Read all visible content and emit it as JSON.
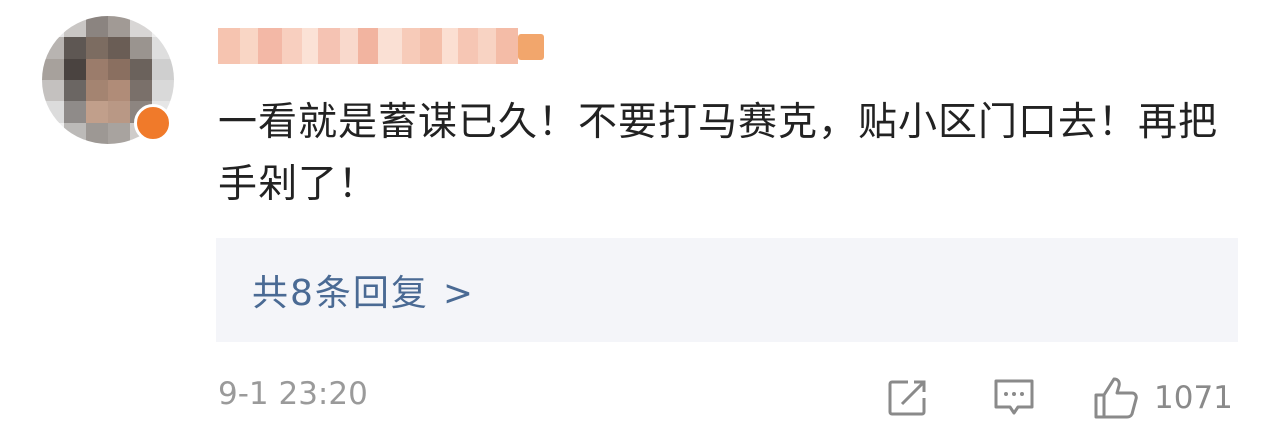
{
  "comment": {
    "avatar": {
      "icon": "user-avatar",
      "badge_color": "#f07a2a",
      "pixels": [
        "#e9e9ea",
        "#c9c6c4",
        "#8b8480",
        "#a19a95",
        "#d8d6d5",
        "#eeeeee",
        "#b8b4b1",
        "#5e5753",
        "#7c6c61",
        "#6a5d55",
        "#9a948f",
        "#dedede",
        "#a7a19c",
        "#4a4340",
        "#9b7c6b",
        "#8a6f60",
        "#6b625c",
        "#cfcfcf",
        "#c4c1bf",
        "#6b6663",
        "#a48471",
        "#b08c78",
        "#7a706a",
        "#d9d9d9",
        "#dcdcdc",
        "#8f8b89",
        "#c19f8b",
        "#b99885",
        "#8d8580",
        "#e6e6e6",
        "#f1f1f1",
        "#bcbab8",
        "#9d9894",
        "#a8a39f",
        "#cfccca",
        "#f3f3f3"
      ]
    },
    "username_pixels": [
      "#f6c4b0",
      "#f9d6c5",
      "#f3b8a6",
      "#f8cfbf",
      "#fbe2d6",
      "#f5c3b3",
      "#f9d9cc",
      "#f2b4a0",
      "#fae0d4",
      "#f7cbb9",
      "#f4bfaa",
      "#fbdfd2",
      "#f6c6b4",
      "#f8d3c3",
      "#f4bca7",
      "#f2a66c"
    ],
    "text": "一看就是蓄谋已久！不要打马赛克，贴小区门口去！再把手剁了！",
    "replies_label": "共8条回复",
    "replies_chevron": ">",
    "timestamp": "9-1 23:20",
    "actions": {
      "share_icon": "share-icon",
      "reply_icon": "comment-icon",
      "like_icon": "thumbs-up-icon",
      "like_count": "1071"
    },
    "colors": {
      "text": "#222222",
      "link": "#4a6a94",
      "meta": "#9a9a9a",
      "reply_bg": "#f4f5f9"
    }
  }
}
